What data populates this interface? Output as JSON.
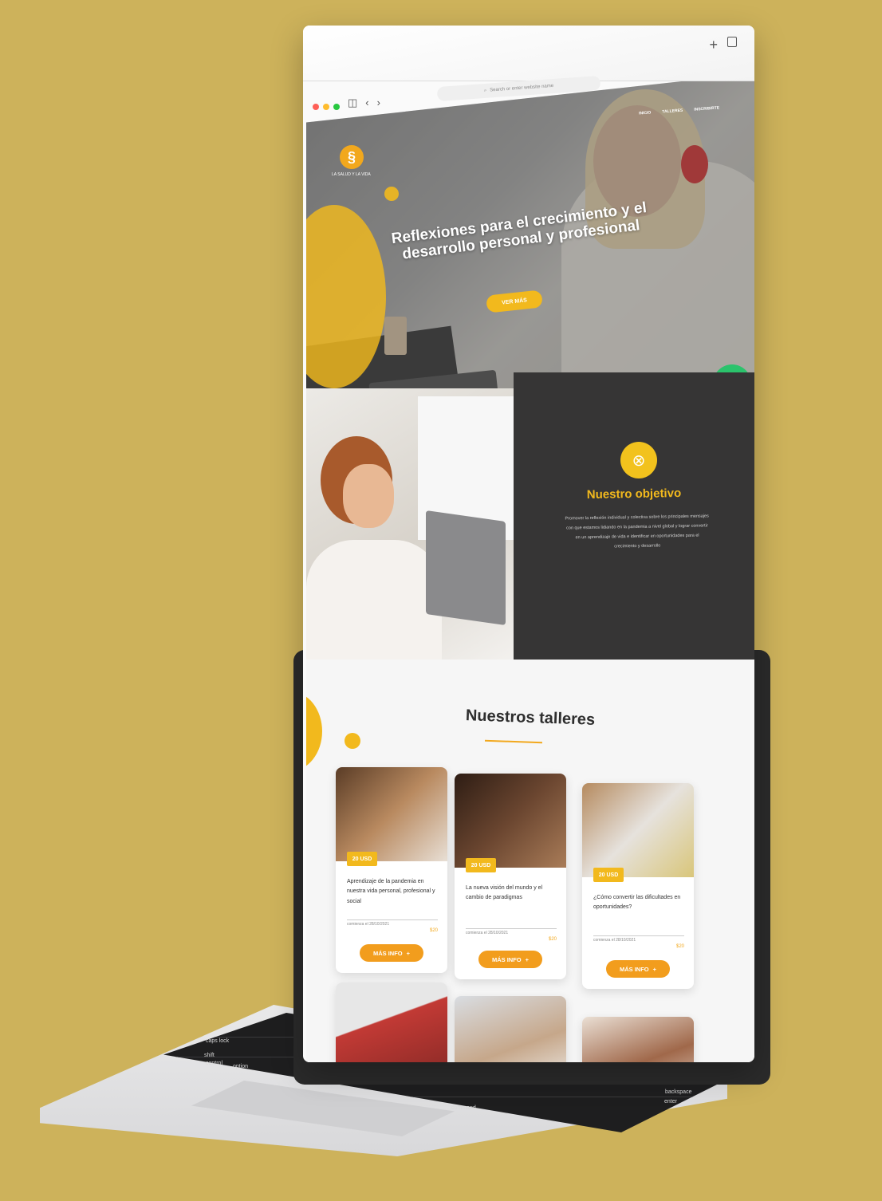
{
  "browser": {
    "address_placeholder": "Search or enter website name"
  },
  "site": {
    "logo_text": "LA SALUD Y LA VIDA",
    "menu": [
      "INICIO",
      "TALLERES",
      "INSCRIBIRTE"
    ]
  },
  "hero": {
    "title": "Reflexiones para el crecimiento y el desarrollo personal y profesional",
    "cta_label": "VER MÁS"
  },
  "objective": {
    "title": "Nuestro objetivo",
    "text": "Promover la reflexión individual y colectiva sobre los principales mensajes con que estamos lidiando en la pandemia a nivel global y lograr convertir en un aprendizaje de vida e identificar en oportunidades para el crecimiento y desarrollo"
  },
  "workshops": {
    "title": "Nuestros talleres",
    "cards": [
      {
        "price": "20 USD",
        "text": "Aprendizaje de la pandemia en nuestra vida personal, profesional y social",
        "date": "comienza el 28/10/2021",
        "cost": "$20",
        "button": "MÁS INFO"
      },
      {
        "price": "20 USD",
        "text": "La nueva visión del mundo y el cambio de paradigmas",
        "date": "comienza el 28/10/2021",
        "cost": "$20",
        "button": "MÁS INFO"
      },
      {
        "price": "20 USD",
        "text": "¿Cómo convertir las dificultades en oportunidades?",
        "date": "comienza el 28/10/2021",
        "cost": "$20",
        "button": "MÁS INFO"
      }
    ]
  },
  "keyboard": {
    "keys": [
      "caps lock",
      "shift",
      "control",
      "option",
      "command",
      "backspace",
      "enter"
    ]
  },
  "colors": {
    "accent": "#f2b91d",
    "background": "#cdb25b",
    "dark_panel": "#363535",
    "whatsapp": "#2bc36c"
  }
}
